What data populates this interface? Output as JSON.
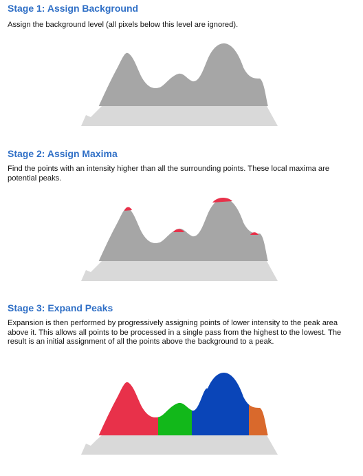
{
  "stages": [
    {
      "title": "Stage 1: Assign Background",
      "description": "Assign the background level (all pixels below this level are ignored)."
    },
    {
      "title": "Stage 2: Assign Maxima",
      "description": "Find the points with an intensity higher than all the surrounding points. These local maxima are potential peaks."
    },
    {
      "title": "Stage 3: Expand Peaks",
      "description": "Expansion is then performed by progressively assigning points of lower intensity to the peak area above it. This allows all points to be processed in a single pass from the highest to the lowest. The result is an initial assignment of all the points above the background to a peak."
    }
  ],
  "colors": {
    "title": "#2f6fc6",
    "background_band": "#d9d9d9",
    "signal": "#a6a6a6",
    "maxima": "#e8314a",
    "peak_red": "#e8314a",
    "peak_green": "#12b81a",
    "peak_blue": "#0a45b8",
    "peak_orange": "#d9692c"
  }
}
